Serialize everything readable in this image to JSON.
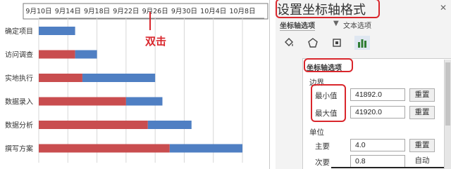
{
  "chart": {
    "annotation": "双击",
    "colors": {
      "planned": "#c94d4f",
      "remaining": "#4f7fc3",
      "accent_red": "#d9262c"
    }
  },
  "chart_data": {
    "type": "bar",
    "orientation": "horizontal-stacked",
    "categories": [
      "确定项目",
      "访问调查",
      "实地执行",
      "数据录入",
      "数据分析",
      "撰写方案"
    ],
    "x_tick_labels": [
      "9月10日",
      "9月14日",
      "9月18日",
      "9月22日",
      "9月26日",
      "9月30日",
      "10月4日",
      "10月8日"
    ],
    "xlim": [
      "9月10日",
      "10月11日"
    ],
    "grid": true,
    "series": [
      {
        "values": [
          0,
          5,
          6,
          12,
          15,
          18
        ]
      },
      {
        "values": [
          5,
          3,
          10,
          5,
          6,
          10
        ]
      }
    ]
  },
  "pane": {
    "title": "设置坐标轴格式",
    "tab_axis_options": "坐标轴选项",
    "tab_text_options": "文本选项",
    "icons": [
      "fill-bucket-icon",
      "pentagon-icon",
      "size-properties-icon",
      "bar-chart-icon"
    ],
    "section_title": "坐标轴选项",
    "bounds_label": "边界",
    "min_label": "最小值",
    "min_value": "41892.0",
    "max_label": "最大值",
    "max_value": "41920.0",
    "reset_label": "重置",
    "units_label": "单位",
    "major_label": "主要",
    "major_value": "4.0",
    "minor_label": "次要",
    "minor_value": "0.8",
    "auto_label": "自动"
  }
}
